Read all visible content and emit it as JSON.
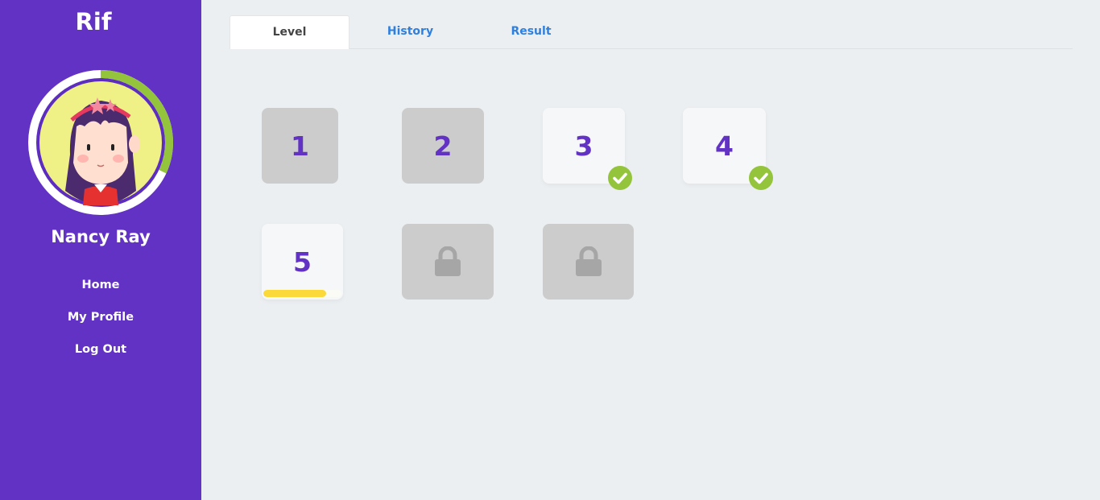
{
  "app": {
    "logo": "Rif"
  },
  "user": {
    "name": "Nancy Ray",
    "profile_progress": 0.32
  },
  "nav": [
    {
      "label": "Home"
    },
    {
      "label": "My Profile"
    },
    {
      "label": "Log Out"
    }
  ],
  "tabs": [
    {
      "label": "Level",
      "active": true
    },
    {
      "label": "History",
      "active": false
    },
    {
      "label": "Result",
      "active": false
    }
  ],
  "levels": [
    {
      "label": "1",
      "state": "available"
    },
    {
      "label": "2",
      "state": "available"
    },
    {
      "label": "3",
      "state": "completed"
    },
    {
      "label": "4",
      "state": "completed"
    },
    {
      "label": "5",
      "state": "in-progress",
      "progress": 0.8
    },
    {
      "label": "",
      "state": "locked"
    },
    {
      "label": "",
      "state": "locked"
    }
  ],
  "colors": {
    "sidebar": "#6232c4",
    "accent_purple": "#6232c4",
    "check_green": "#94c43c",
    "progress_yellow": "#fbd93a",
    "tab_link": "#2f80de",
    "tile_locked": "#cccccc"
  },
  "icons": {
    "completed": "check-circle-icon",
    "locked": "lock-icon"
  }
}
